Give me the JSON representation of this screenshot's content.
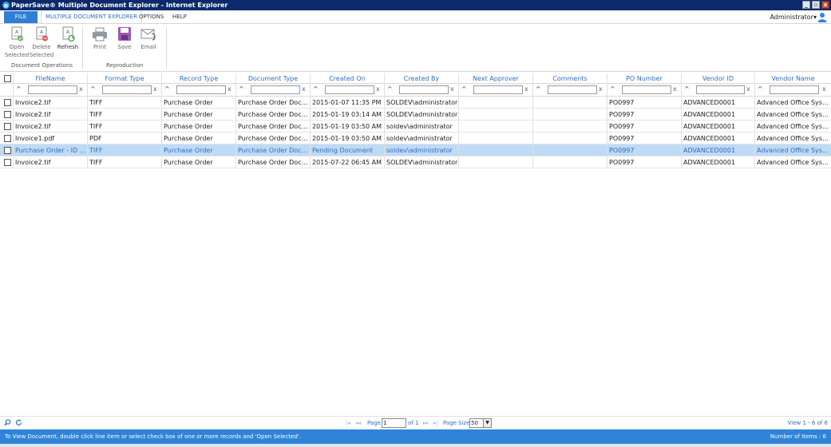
{
  "window": {
    "title": "PaperSave® Multiple Document Explorer - Internet Explorer",
    "buttons": {
      "minimize": "_",
      "restore": "▫",
      "close": "x"
    }
  },
  "menu": {
    "file": "FILE",
    "items": [
      "MULTIPLE DOCUMENT EXPLORER",
      "OPTIONS",
      "HELP"
    ],
    "user": "Administrator▾"
  },
  "ribbon": {
    "groups": [
      {
        "label": "Document Operations",
        "buttons": [
          {
            "label": "Open",
            "label2": "Selected",
            "icon": "open-document-icon",
            "enabled": false
          },
          {
            "label": "Delete",
            "label2": "Selected",
            "icon": "delete-document-icon",
            "enabled": false
          },
          {
            "label": "Refresh",
            "label2": "",
            "icon": "refresh-icon",
            "enabled": true
          }
        ]
      },
      {
        "label": "Reproduction",
        "buttons": [
          {
            "label": "Print",
            "icon": "print-icon",
            "enabled": false
          },
          {
            "label": "Save",
            "icon": "save-icon",
            "enabled": false
          },
          {
            "label": "Email",
            "icon": "email-icon",
            "enabled": false
          }
        ]
      }
    ]
  },
  "grid": {
    "columns": [
      "FileName",
      "Format Type",
      "Record Type",
      "Document Type",
      "Created On",
      "Created By",
      "Next Approver",
      "Comments",
      "PO Number",
      "Vendor ID",
      "Vendor Name"
    ],
    "filter": {
      "caret": "^",
      "clear": "x"
    },
    "rows": [
      {
        "cells": [
          "Invoice2.tif",
          "TIFF",
          "Purchase Order",
          "Purchase Order Document",
          "2015-01-07 11:35 PM",
          "SOLDEV\\administrator",
          "",
          "",
          "PO0997",
          "ADVANCED0001",
          "Advanced Office Systems"
        ],
        "selected": false
      },
      {
        "cells": [
          "Invoice2.tif",
          "TIFF",
          "Purchase Order",
          "Purchase Order Document",
          "2015-01-19 03:14 AM",
          "SOLDEV\\administrator",
          "",
          "",
          "PO0997",
          "ADVANCED0001",
          "Advanced Office Systems"
        ],
        "selected": false
      },
      {
        "cells": [
          "Invoice2.tif",
          "TIFF",
          "Purchase Order",
          "Purchase Order Document",
          "2015-01-19 03:50 AM",
          "soldev\\administrator",
          "",
          "",
          "PO0997",
          "ADVANCED0001",
          "Advanced Office Systems"
        ],
        "selected": false
      },
      {
        "cells": [
          "Invoice1.pdf",
          "PDF",
          "Purchase Order",
          "Purchase Order Document",
          "2015-01-19 03:50 AM",
          "soldev\\administrator",
          "",
          "",
          "PO0997",
          "ADVANCED0001",
          "Advanced Office Systems"
        ],
        "selected": false
      },
      {
        "cells": [
          "Purchase Order - ID - -...",
          "TIFF",
          "Purchase Order",
          "Purchase Order Document",
          "Pending Document",
          "soldev\\administrator",
          "",
          "",
          "PO0997",
          "ADVANCED0001",
          "Advanced Office Systems"
        ],
        "selected": true
      },
      {
        "cells": [
          "Invoice2.tif",
          "TIFF",
          "Purchase Order",
          "Purchase Order Document",
          "2015-07-22 06:45 AM",
          "SOLDEV\\administrator",
          "",
          "",
          "PO0997",
          "ADVANCED0001",
          "Advanced Office Systems"
        ],
        "selected": false
      }
    ]
  },
  "pager": {
    "first": "|◂",
    "prev": "◂◂",
    "page_label": "Page",
    "page_value": "1",
    "of_label": "of 1",
    "next": "▸▸",
    "last": "▸|",
    "page_size_label": "Page Size",
    "page_size_value": "50",
    "view_info": "View 1 - 6 of 6"
  },
  "status": {
    "message": "To View Document, double click line item or select check box of one or more records and 'Open Selected'.",
    "count": "Number of Items : 6"
  },
  "colors": {
    "accent": "#2f6fc1",
    "title_bar": "#0b2a6b",
    "status_bar": "#2f84d9",
    "selected_row": "#bedaf5"
  }
}
